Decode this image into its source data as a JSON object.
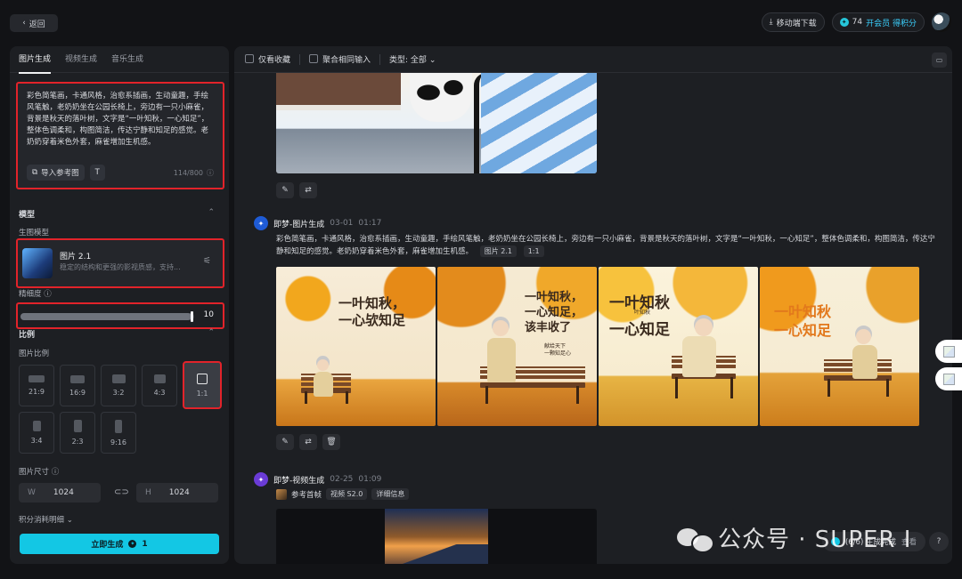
{
  "topbar": {
    "back_label": "返回",
    "mobile_download": "移动端下载",
    "credits": "74",
    "membership": "开会员 得积分"
  },
  "left_panel": {
    "tabs": [
      {
        "label": "图片生成",
        "active": true
      },
      {
        "label": "视频生成",
        "active": false
      },
      {
        "label": "音乐生成",
        "active": false
      }
    ],
    "prompt": {
      "text": "彩色简笔画，卡通风格，治愈系插画，生动童趣，手绘风笔触，老奶奶坐在公园长椅上，旁边有一只小麻雀，背景是秋天的落叶树，文字是“一叶知秋，一心知足”，整体色调柔和，构图简洁，传达宁静和知足的感觉。老奶奶穿着米色外套，麻雀增加生机感。",
      "import_ref_label": "导入参考图",
      "char_count": "114/800"
    },
    "model_section": {
      "title": "模型",
      "sub_label": "生图模型",
      "model_name": "图片 2.1",
      "model_desc": "稳定的结构和更强的影视质感，支持..."
    },
    "fineness": {
      "label": "精细度",
      "value": "10",
      "fraction": 1.0
    },
    "ratio_section": {
      "title": "比例",
      "sub_label": "图片比例",
      "options": [
        {
          "label": "21:9",
          "selected": false
        },
        {
          "label": "16:9",
          "selected": false
        },
        {
          "label": "3:2",
          "selected": false
        },
        {
          "label": "4:3",
          "selected": false
        },
        {
          "label": "1:1",
          "selected": true
        },
        {
          "label": "3:4",
          "selected": false
        },
        {
          "label": "2:3",
          "selected": false
        },
        {
          "label": "9:16",
          "selected": false
        }
      ]
    },
    "size_section": {
      "label": "图片尺寸",
      "w_axis": "W",
      "w_value": "1024",
      "h_axis": "H",
      "h_value": "1024"
    },
    "cost_label": "积分消耗明细",
    "generate_label": "立即生成",
    "generate_cost": "1"
  },
  "main": {
    "filters": {
      "favorites": "仅看收藏",
      "merge": "聚合相同输入",
      "type": "类型: 全部"
    },
    "entry1": {
      "title": "即梦-图片生成",
      "date": "03-01",
      "time": "01:17",
      "prompt": "彩色简笔画，卡通风格，治愈系插画，生动童趣，手绘风笔触，老奶奶坐在公园长椅上，旁边有一只小麻雀，背景是秋天的落叶树，文字是“一叶知秋，一心知足”，整体色调柔和，构图简洁，传达宁静和知足的感觉。老奶奶穿着米色外套，麻雀增加生机感。",
      "tag_model": "图片 2.1",
      "tag_ratio": "1:1",
      "images": [
        {
          "text": "一叶知秋，\n一心欤知足"
        },
        {
          "text": "一叶知秋，\n一心知足，\n该丰收了",
          "small": "献给天下\n一颗知足心"
        },
        {
          "text": "一叶知秋\n一心知足",
          "small": "叶知秋"
        },
        {
          "text": "一叶知秋\n一心知足"
        }
      ]
    },
    "entry2": {
      "title": "即梦-视频生成",
      "date": "02-25",
      "time": "01:09",
      "ref_label": "参考首帧",
      "tag_model": "视频 S2.0",
      "tag_detail": "详细信息"
    },
    "status": "(6/6) 生成完成",
    "status_tail": "查看",
    "help": "?"
  },
  "watermark": {
    "text": "公众号 · SUPER I"
  },
  "colors": {
    "accent": "#13c7e4",
    "highlight_border": "#e2232a",
    "panel_bg": "#1d1f23"
  }
}
